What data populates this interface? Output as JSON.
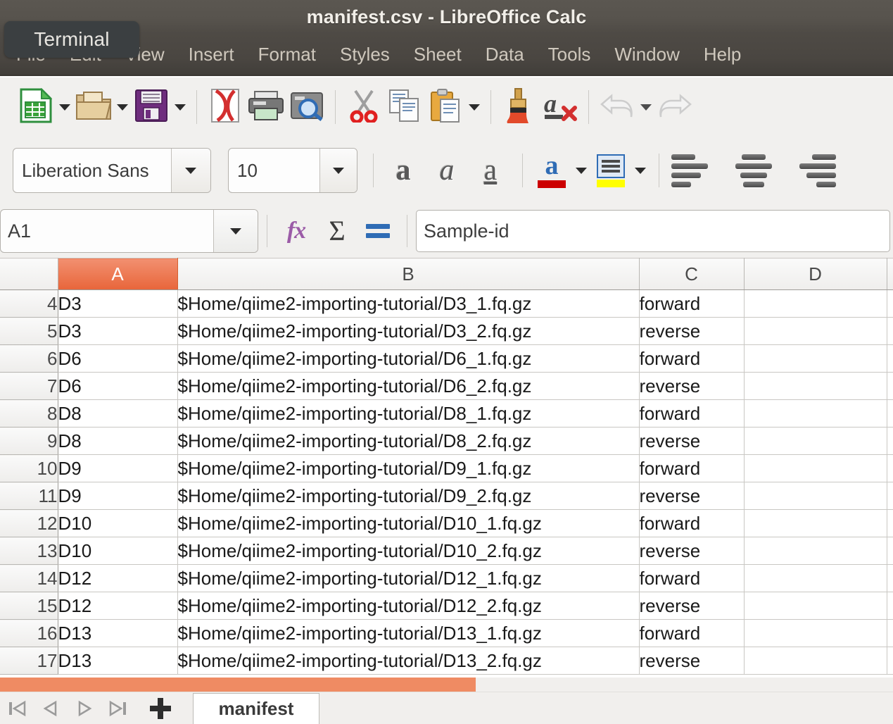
{
  "window": {
    "title": "manifest.csv - LibreOffice Calc"
  },
  "tooltip": {
    "label": "Terminal"
  },
  "menubar": {
    "items": [
      {
        "label": "File"
      },
      {
        "label": "Edit"
      },
      {
        "label": "View"
      },
      {
        "label": "Insert"
      },
      {
        "label": "Format"
      },
      {
        "label": "Styles"
      },
      {
        "label": "Sheet"
      },
      {
        "label": "Data"
      },
      {
        "label": "Tools"
      },
      {
        "label": "Window"
      },
      {
        "label": "Help"
      }
    ]
  },
  "standard_toolbar": {
    "items": [
      {
        "name": "new-document-icon",
        "tooltip": "New"
      },
      {
        "name": "open-file-icon",
        "tooltip": "Open"
      },
      {
        "name": "save-icon",
        "tooltip": "Save"
      },
      {
        "name": "export-pdf-icon",
        "tooltip": "Export as PDF"
      },
      {
        "name": "print-icon",
        "tooltip": "Print"
      },
      {
        "name": "print-preview-icon",
        "tooltip": "Toggle Print Preview"
      },
      {
        "name": "cut-icon",
        "tooltip": "Cut"
      },
      {
        "name": "copy-icon",
        "tooltip": "Copy"
      },
      {
        "name": "paste-icon",
        "tooltip": "Paste"
      },
      {
        "name": "clone-formatting-icon",
        "tooltip": "Clone Formatting"
      },
      {
        "name": "clear-formatting-icon",
        "tooltip": "Clear Direct Formatting"
      },
      {
        "name": "undo-icon",
        "tooltip": "Undo"
      },
      {
        "name": "redo-icon",
        "tooltip": "Redo"
      }
    ]
  },
  "formatting_toolbar": {
    "font_name": "Liberation Sans",
    "font_size": "10",
    "bold_label": "a",
    "italic_label": "a",
    "underline_label": "a",
    "font_color_label": "a",
    "font_color_hex": "#cc0000",
    "highlight_color_hex": "#ffff00",
    "items": [
      {
        "name": "bold-button"
      },
      {
        "name": "italic-button"
      },
      {
        "name": "underline-button"
      },
      {
        "name": "font-color-button"
      },
      {
        "name": "highlight-color-button"
      },
      {
        "name": "align-left-button"
      },
      {
        "name": "align-center-button"
      },
      {
        "name": "align-right-button"
      }
    ]
  },
  "formula_bar": {
    "name_box": "A1",
    "input_line": "Sample-id",
    "function_wizard_label": "fx",
    "sum_label": "Σ",
    "formula_label": "="
  },
  "sheet": {
    "active_cell": "A1",
    "active_column": "A",
    "column_headers": [
      "A",
      "B",
      "C",
      "D"
    ],
    "rows": [
      {
        "num": "4",
        "a": "D3",
        "b": "$Home/qiime2-importing-tutorial/D3_1.fq.gz",
        "c": "forward",
        "d": ""
      },
      {
        "num": "5",
        "a": "D3",
        "b": "$Home/qiime2-importing-tutorial/D3_2.fq.gz",
        "c": "reverse",
        "d": ""
      },
      {
        "num": "6",
        "a": "D6",
        "b": "$Home/qiime2-importing-tutorial/D6_1.fq.gz",
        "c": "forward",
        "d": ""
      },
      {
        "num": "7",
        "a": "D6",
        "b": "$Home/qiime2-importing-tutorial/D6_2.fq.gz",
        "c": "reverse",
        "d": ""
      },
      {
        "num": "8",
        "a": "D8",
        "b": "$Home/qiime2-importing-tutorial/D8_1.fq.gz",
        "c": "forward",
        "d": ""
      },
      {
        "num": "9",
        "a": "D8",
        "b": "$Home/qiime2-importing-tutorial/D8_2.fq.gz",
        "c": "reverse",
        "d": ""
      },
      {
        "num": "10",
        "a": "D9",
        "b": "$Home/qiime2-importing-tutorial/D9_1.fq.gz",
        "c": "forward",
        "d": ""
      },
      {
        "num": "11",
        "a": "D9",
        "b": "$Home/qiime2-importing-tutorial/D9_2.fq.gz",
        "c": "reverse",
        "d": ""
      },
      {
        "num": "12",
        "a": "D10",
        "b": "$Home/qiime2-importing-tutorial/D10_1.fq.gz",
        "c": "forward",
        "d": ""
      },
      {
        "num": "13",
        "a": "D10",
        "b": "$Home/qiime2-importing-tutorial/D10_2.fq.gz",
        "c": "reverse",
        "d": ""
      },
      {
        "num": "14",
        "a": "D12",
        "b": "$Home/qiime2-importing-tutorial/D12_1.fq.gz",
        "c": "forward",
        "d": ""
      },
      {
        "num": "15",
        "a": "D12",
        "b": "$Home/qiime2-importing-tutorial/D12_2.fq.gz",
        "c": "reverse",
        "d": ""
      },
      {
        "num": "16",
        "a": "D13",
        "b": "$Home/qiime2-importing-tutorial/D13_1.fq.gz",
        "c": "forward",
        "d": ""
      },
      {
        "num": "17",
        "a": "D13",
        "b": "$Home/qiime2-importing-tutorial/D13_2.fq.gz",
        "c": "reverse",
        "d": ""
      }
    ]
  },
  "tabbar": {
    "first_sheet_label": "⏮",
    "prev_sheet_label": "◀",
    "next_sheet_label": "▶",
    "last_sheet_label": "⏭",
    "add_sheet_label": "+",
    "sheet_name": "manifest"
  },
  "colors": {
    "accent_orange": "#e8653a",
    "scrollbar_thumb": "#ef8b63",
    "titlebar": "#57534d",
    "toolbar_bg": "#f1f0ee"
  }
}
